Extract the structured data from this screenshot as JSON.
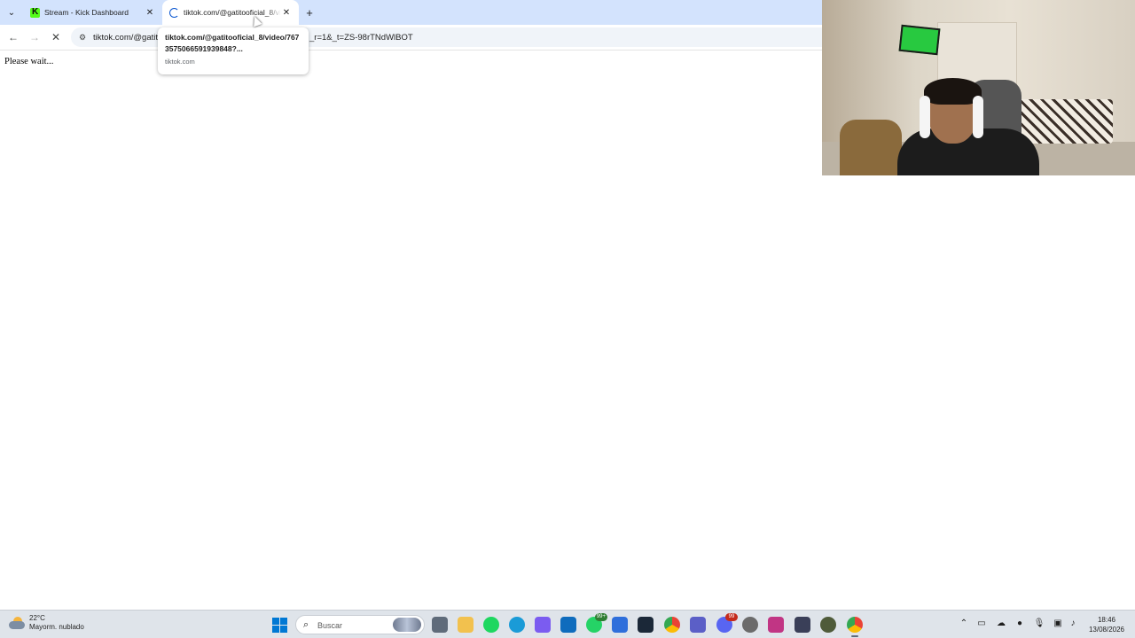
{
  "browser": {
    "tabs": [
      {
        "title": "Stream - Kick Dashboard",
        "close": "✕"
      },
      {
        "title": "tiktok.com/@gatitooficial_8/video/7673575066591939848?_r=1&_t=ZS-98rTNdWlBOT",
        "close": "✕"
      }
    ],
    "new_tab": "+",
    "url_prefix": "tiktok.com/@gatitooficial_8/video/7673575066591939848?",
    "url_suffix": "_r=1&_t=ZS-98rTNdWlBOT",
    "hovercard": {
      "title": "tiktok.com/@gatitooficial_8/video/7673575066591939848?...",
      "domain": "tiktok.com"
    }
  },
  "page": {
    "text": "Please wait..."
  },
  "taskbar": {
    "weather": {
      "temp": "22°C",
      "desc": "Mayorm. nublado"
    },
    "search_placeholder": "Buscar",
    "badges": {
      "whatsapp": "99+",
      "discord": "99"
    },
    "clock": {
      "time": "18:46",
      "date": "13/08/2026"
    }
  },
  "colors": {
    "tabstrip": "#d3e3fd",
    "omnibox": "#f0f4f9",
    "kick_green": "#53fc18",
    "windows_blue": "#0078d4"
  }
}
